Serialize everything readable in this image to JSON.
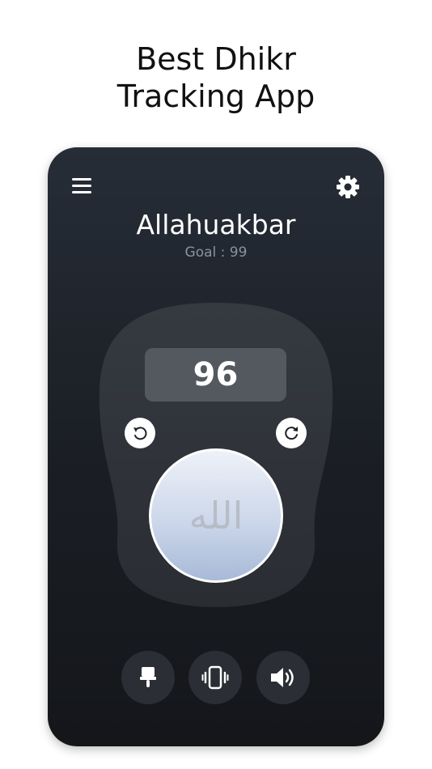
{
  "promo": {
    "line1": "Best Dhikr",
    "line2": "Tracking App"
  },
  "header": {
    "menu_icon": "hamburger-icon",
    "settings_icon": "gear-icon"
  },
  "dhikr": {
    "name": "Allahuakbar",
    "goal_text": "Goal : 99"
  },
  "counter": {
    "count": "96",
    "tap_glyph": "الله",
    "undo_icon": "undo-icon",
    "reset_icon": "refresh-icon"
  },
  "bottom_controls": [
    {
      "icon": "paint-brush-icon"
    },
    {
      "icon": "vibrate-icon"
    },
    {
      "icon": "speaker-icon"
    }
  ],
  "colors": {
    "background_top": "#262d37",
    "background_bottom": "#14161a",
    "counter_body": "#30343a",
    "display": "#545960",
    "tap_button_top": "#eef1f8",
    "tap_button_bottom": "#a7bad7",
    "goal_text": "#8c929a"
  }
}
